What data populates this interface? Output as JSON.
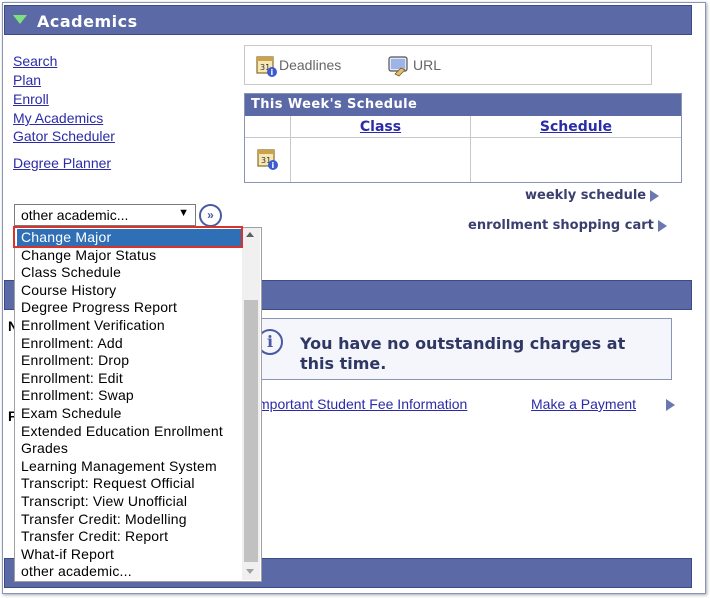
{
  "header": {
    "title": "Academics"
  },
  "nav_links": [
    {
      "label": "Search",
      "name": "nav-search"
    },
    {
      "label": "Plan",
      "name": "nav-plan"
    },
    {
      "label": "Enroll",
      "name": "nav-enroll"
    },
    {
      "label": "My Academics",
      "name": "nav-my-academics"
    },
    {
      "label": "Gator Scheduler",
      "name": "nav-gator-scheduler"
    },
    {
      "label": "Degree Planner",
      "name": "nav-degree-planner"
    }
  ],
  "quick_links": {
    "deadlines": "Deadlines",
    "url": "URL"
  },
  "schedule": {
    "title": "This Week's Schedule",
    "col_class": "Class",
    "col_schedule": "Schedule"
  },
  "right_links": {
    "weekly": "weekly schedule",
    "cart": "enrollment shopping cart"
  },
  "select": {
    "value": "other academic...",
    "go": "»"
  },
  "dropdown_options": [
    "Change Major",
    "Change Major Status",
    "Class Schedule",
    "Course History",
    "Degree Progress Report",
    "Enrollment Verification",
    "Enrollment: Add",
    "Enrollment: Drop",
    "Enrollment: Edit",
    "Enrollment: Swap",
    "Exam Schedule",
    "Extended Education Enrollment",
    "Grades",
    "Learning Management System",
    "Transcript: Request Official",
    "Transcript: View Unofficial",
    "Transfer Credit: Modelling",
    "Transfer Credit: Report",
    "What-if Report",
    "other academic..."
  ],
  "selected_index": 0,
  "finances": {
    "message": "You have no outstanding charges at this time.",
    "fee_link": "mportant Student Fee Information",
    "payment_link": "Make a Payment"
  },
  "colors": {
    "bar": "#5b6aa6",
    "link": "#2b2ba8",
    "selected": "#2f6fb5",
    "highlight": "#d9342b"
  }
}
